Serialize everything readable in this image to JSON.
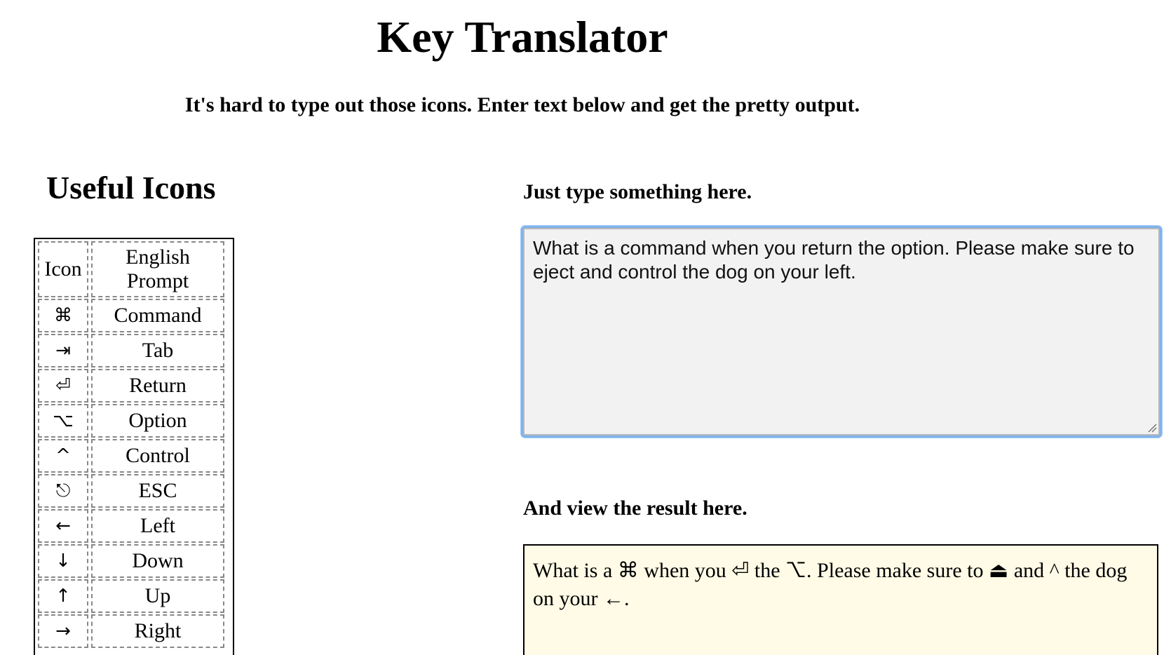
{
  "header": {
    "title": "Key Translator",
    "subtitle": "It's hard to type out those icons. Enter text below and get the pretty output."
  },
  "icons_panel": {
    "heading": "Useful Icons",
    "columns": [
      "Icon",
      "English Prompt"
    ],
    "rows": [
      {
        "icon": "⌘",
        "prompt": "Command"
      },
      {
        "icon": "⇥",
        "prompt": "Tab"
      },
      {
        "icon": "⏎",
        "prompt": "Return"
      },
      {
        "icon": "⌥",
        "prompt": "Option"
      },
      {
        "icon": "^",
        "prompt": "Control"
      },
      {
        "icon": "⎋",
        "prompt": "ESC"
      },
      {
        "icon": "←",
        "prompt": "Left"
      },
      {
        "icon": "↓",
        "prompt": "Down"
      },
      {
        "icon": "↑",
        "prompt": "Up"
      },
      {
        "icon": "→",
        "prompt": "Right"
      }
    ]
  },
  "input": {
    "label": "Just type something here.",
    "value": "What is a command when you return the option. Please make sure to eject and control the dog on your left."
  },
  "output": {
    "label": "And view the result here.",
    "text": "What is a ⌘ when you ⏎ the ⌥. Please make sure to ⏏ and ^ the dog on your ←."
  },
  "colors": {
    "input_background": "#f2f2f2",
    "input_focus_ring": "#7fb3ee",
    "output_background": "#fffbe6"
  }
}
